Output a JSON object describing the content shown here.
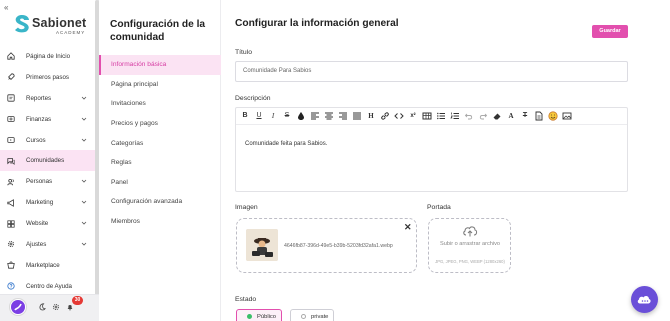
{
  "brand": {
    "name": "Sabionet",
    "sub": "ACADEMY",
    "collapse_icon": "«"
  },
  "nav": {
    "items": [
      {
        "label": "Página de Inicio",
        "icon": "home-icon",
        "has_chevron": false,
        "active": false
      },
      {
        "label": "Primeros pasos",
        "icon": "rocket-icon",
        "has_chevron": false,
        "active": false
      },
      {
        "label": "Reportes",
        "icon": "report-icon",
        "has_chevron": true,
        "active": false
      },
      {
        "label": "Finanzas",
        "icon": "finance-icon",
        "has_chevron": true,
        "active": false
      },
      {
        "label": "Cursos",
        "icon": "courses-icon",
        "has_chevron": true,
        "active": false
      },
      {
        "label": "Comunidades",
        "icon": "community-icon",
        "has_chevron": false,
        "active": true
      },
      {
        "label": "Personas",
        "icon": "people-icon",
        "has_chevron": true,
        "active": false
      },
      {
        "label": "Marketing",
        "icon": "marketing-icon",
        "has_chevron": true,
        "active": false
      },
      {
        "label": "Website",
        "icon": "website-icon",
        "has_chevron": true,
        "active": false
      },
      {
        "label": "Ajustes",
        "icon": "gear-icon",
        "has_chevron": true,
        "active": false
      },
      {
        "label": "Marketplace",
        "icon": "marketplace-icon",
        "has_chevron": false,
        "active": false
      },
      {
        "label": "Centro de Ayuda",
        "icon": "help-icon",
        "has_chevron": false,
        "active": false
      }
    ]
  },
  "bottom_bar": {
    "notification_count": "30"
  },
  "sub_panel": {
    "title": "Configuración de la comunidad",
    "items": [
      {
        "label": "Información básica",
        "active": true
      },
      {
        "label": "Página principal",
        "active": false
      },
      {
        "label": "Invitaciones",
        "active": false
      },
      {
        "label": "Precios y pagos",
        "active": false
      },
      {
        "label": "Categorías",
        "active": false
      },
      {
        "label": "Reglas",
        "active": false
      },
      {
        "label": "Panel",
        "active": false
      },
      {
        "label": "Configuración avanzada",
        "active": false
      },
      {
        "label": "Miembros",
        "active": false
      }
    ]
  },
  "main": {
    "title": "Configurar la información general",
    "save_label": "Guardar",
    "titulo_label": "Título",
    "titulo_value": "Comunidade Para Sabios",
    "descripcion_label": "Descripción",
    "descripcion_text": "Comunidade feita para Sabios.",
    "imagen_label": "Imagen",
    "image_file_name": "4646fb87-396d-49e5-b39b-5203fd32afa1.webp",
    "portada_label": "Portada",
    "upload_text": "Subir o arrastrar archivo",
    "upload_formats": "JPG, JPEG, PNG, WEBP (1280x260)",
    "estado_label": "Estado",
    "estado_options": [
      {
        "label": "Público",
        "selected": true
      },
      {
        "label": "private",
        "selected": false
      }
    ]
  },
  "colors": {
    "accent": "#e24fae",
    "active_bg": "#fbe3f3",
    "fab": "#6a4fd8",
    "badge": "#e53935",
    "selected_dot": "#3bbf6a"
  }
}
